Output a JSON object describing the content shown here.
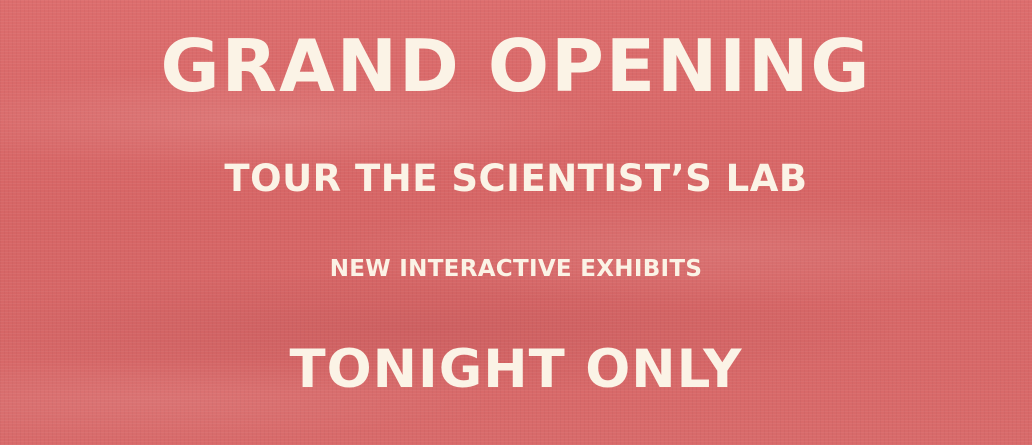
{
  "banner": {
    "headline": "GRAND OPENING",
    "subheading": "TOUR THE SCIENTIST’S LAB",
    "tagline": "NEW INTERACTIVE EXHIBITS",
    "closing": "TONIGHT ONLY"
  },
  "colors": {
    "background": "#d86868",
    "text": "#fbf3e6"
  }
}
